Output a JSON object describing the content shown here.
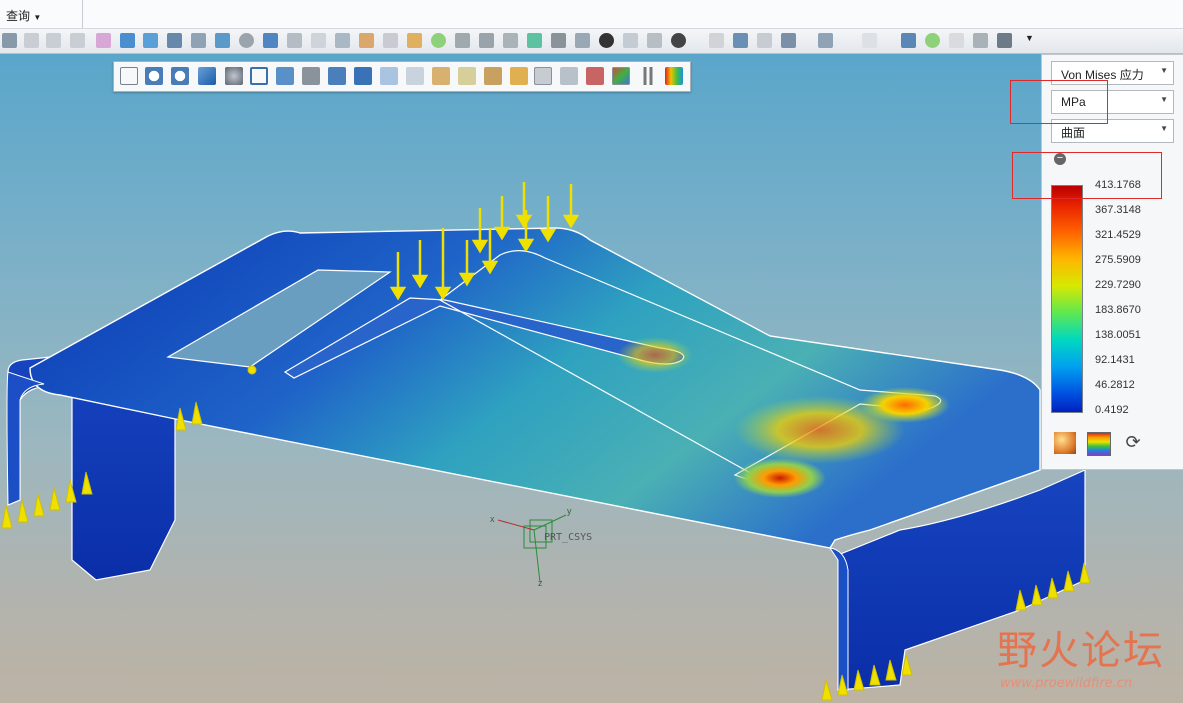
{
  "menubar": {
    "query_menu": "查询"
  },
  "view_toolbar": {
    "active_tool": "show-loads-constraints"
  },
  "legend": {
    "result_type": "Von Mises 应力",
    "unit": "MPa",
    "display_mode": "曲面",
    "collapse_symbol": "−",
    "values": [
      "413.1768",
      "367.3148",
      "321.4529",
      "275.5909",
      "229.7290",
      "183.8670",
      "138.0051",
      "92.1431",
      "46.2812",
      "0.4192"
    ],
    "colors": [
      "#b80000",
      "#ff6000",
      "#ffb400",
      "#d8e800",
      "#60e850",
      "#00d8c0",
      "#00a0f0",
      "#0050e0",
      "#0020c0"
    ]
  },
  "model": {
    "csys_label": "PRT_CSYS",
    "axis_x": "x",
    "axis_y": "y",
    "axis_z": "z"
  },
  "watermark": {
    "title": "野火论坛",
    "url": "www.proewildfire.cn"
  },
  "annotations": {
    "highlight_color": "#e02a2a"
  }
}
